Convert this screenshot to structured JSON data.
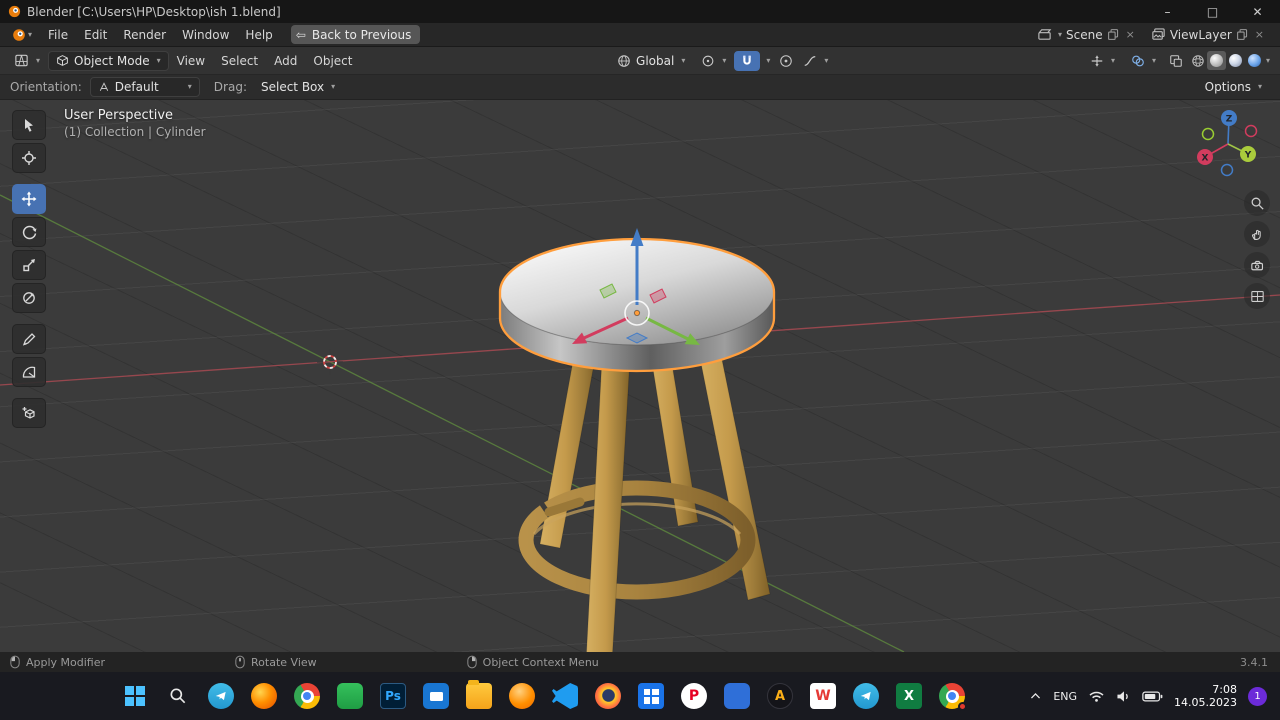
{
  "colors": {
    "accent_blue": "#4772b3",
    "selection_outline": "#ff9e3d",
    "wood": "#c9a35b",
    "viewport_bg": "#3b3b3b",
    "axis_x": "#d23c5e",
    "axis_y": "#77b843",
    "axis_z": "#437cc7"
  },
  "titlebar": {
    "title": "Blender [C:\\Users\\HP\\Desktop\\ish 1.blend]"
  },
  "menubar": {
    "menus": [
      "File",
      "Edit",
      "Render",
      "Window",
      "Help"
    ],
    "back_button": "Back to Previous",
    "scene_label": "Scene",
    "viewlayer_label": "ViewLayer"
  },
  "header": {
    "mode": "Object Mode",
    "menus": [
      "View",
      "Select",
      "Add",
      "Object"
    ],
    "transform_orientation": "Global"
  },
  "toolrow": {
    "orientation_label": "Orientation:",
    "orientation_value": "Default",
    "drag_label": "Drag:",
    "drag_value": "Select Box",
    "options": "Options"
  },
  "viewport": {
    "perspective_label": "User Perspective",
    "collection_label": "(1) Collection | Cylinder",
    "gizmo": {
      "x": "X",
      "y": "Y",
      "z": "Z"
    }
  },
  "statusbar": {
    "lmb": "Apply Modifier",
    "mmb": "Rotate View",
    "rmb": "Object Context Menu",
    "version": "3.4.1"
  },
  "taskbar": {
    "icons": [
      {
        "name": "start"
      },
      {
        "name": "search"
      },
      {
        "name": "telegram"
      },
      {
        "name": "firefox-nightly"
      },
      {
        "name": "chrome"
      },
      {
        "name": "green-app"
      },
      {
        "name": "photoshop",
        "label": "Ps"
      },
      {
        "name": "media-app"
      },
      {
        "name": "file-explorer"
      },
      {
        "name": "orange-app"
      },
      {
        "name": "vscode"
      },
      {
        "name": "firefox"
      },
      {
        "name": "blue-grid-app"
      },
      {
        "name": "pinterest",
        "label": "P"
      },
      {
        "name": "blue-app"
      },
      {
        "name": "dark-app",
        "label": "A"
      },
      {
        "name": "red-w-app",
        "label": "W"
      },
      {
        "name": "telegram-2"
      },
      {
        "name": "excel",
        "label": "X"
      },
      {
        "name": "chrome-profile"
      }
    ],
    "tray": {
      "language": "ENG",
      "time": "7:08",
      "date": "14.05.2023",
      "badge": "1"
    }
  }
}
